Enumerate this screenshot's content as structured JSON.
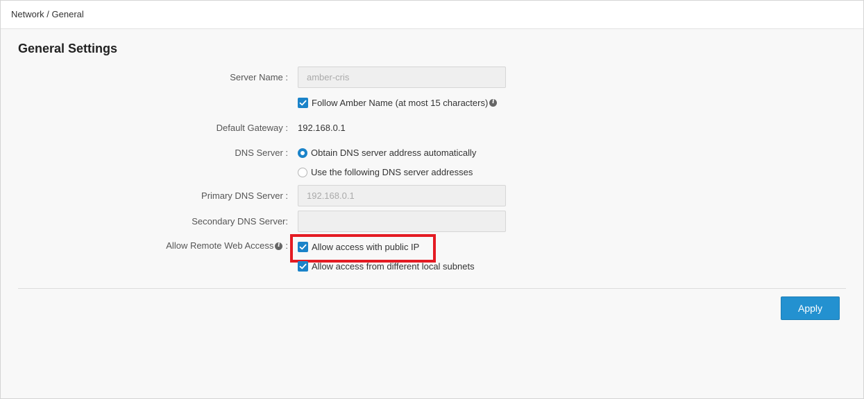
{
  "breadcrumb": "Network / General",
  "title": "General Settings",
  "fields": {
    "server_name": {
      "label": "Server Name :",
      "placeholder": "amber-cris"
    },
    "follow_name": {
      "label": "Follow Amber Name (at most 15 characters)",
      "checked": true
    },
    "default_gateway": {
      "label": "Default Gateway :",
      "value": "192.168.0.1"
    },
    "dns_server": {
      "label": "DNS Server :",
      "options": [
        {
          "label": "Obtain DNS server address automatically",
          "selected": true
        },
        {
          "label": "Use the following DNS server addresses",
          "selected": false
        }
      ]
    },
    "primary_dns": {
      "label": "Primary DNS Server :",
      "placeholder": "192.168.0.1"
    },
    "secondary_dns": {
      "label": "Secondary DNS Server:",
      "placeholder": ""
    },
    "remote_access": {
      "label": "Allow Remote Web Access",
      "label_suffix": ":",
      "options": [
        {
          "label": "Allow access with public IP",
          "checked": true
        },
        {
          "label": "Allow access from different local subnets",
          "checked": true
        }
      ]
    }
  },
  "apply_label": "Apply",
  "colors": {
    "accent": "#1b83c9",
    "button": "#2391d0",
    "highlight": "#e41b23"
  },
  "icons": {
    "checkbox_checked": "check-icon",
    "info": "info-icon"
  }
}
